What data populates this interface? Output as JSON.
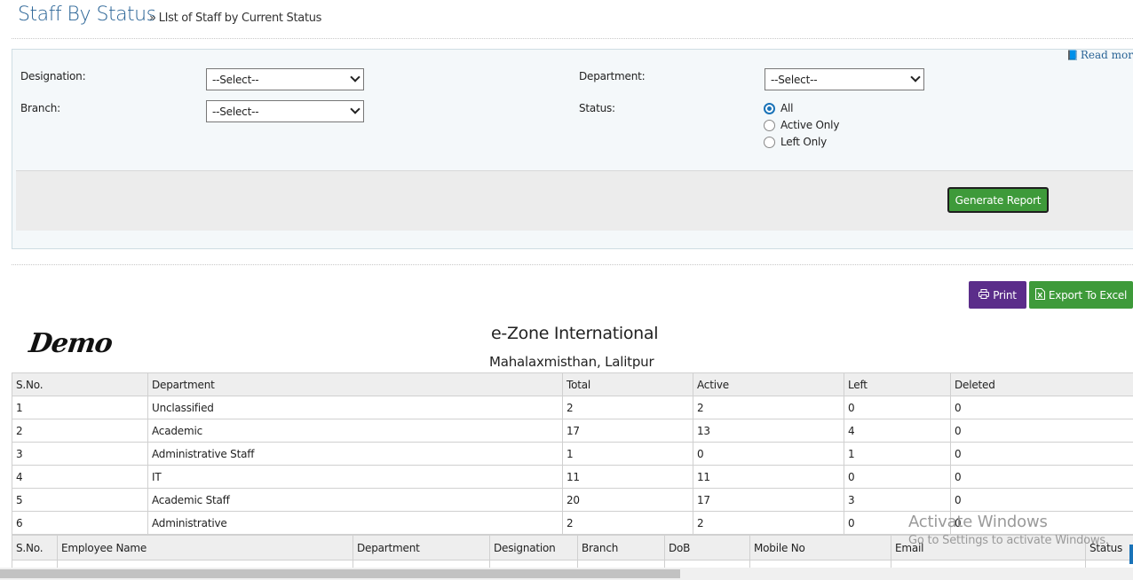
{
  "page": {
    "title": "Staff By Status",
    "subtitle": "LIst of Staff by Current Status",
    "read_more": "Read mor"
  },
  "filters": {
    "designation_label": "Designation:",
    "designation_value": "--Select--",
    "branch_label": "Branch:",
    "branch_value": "--Select--",
    "department_label": "Department:",
    "department_value": "--Select--",
    "status_label": "Status:",
    "status_options": [
      {
        "label": "All",
        "selected": true
      },
      {
        "label": "Active Only",
        "selected": false
      },
      {
        "label": "Left Only",
        "selected": false
      }
    ],
    "generate_label": "Generate Report"
  },
  "report": {
    "print_label": "Print",
    "excel_label": "Export To Excel",
    "org_name": "e-Zone International",
    "address": "Mahalaxmisthan, Lalitpur",
    "logo_text": "Demo"
  },
  "summary": {
    "headers": [
      "S.No.",
      "Department",
      "Total",
      "Active",
      "Left",
      "Deleted"
    ],
    "rows": [
      [
        "1",
        "Unclassified",
        "2",
        "2",
        "0",
        "0"
      ],
      [
        "2",
        "Academic",
        "17",
        "13",
        "4",
        "0"
      ],
      [
        "3",
        "Administrative Staff",
        "1",
        "0",
        "1",
        "0"
      ],
      [
        "4",
        "IT",
        "11",
        "11",
        "0",
        "0"
      ],
      [
        "5",
        "Academic Staff",
        "20",
        "17",
        "3",
        "0"
      ],
      [
        "6",
        "Administrative",
        "2",
        "2",
        "0",
        "0"
      ]
    ]
  },
  "detail": {
    "headers": [
      "S.No.",
      "Employee Name",
      "Department",
      "Designation",
      "Branch",
      "DoB",
      "Mobile No",
      "Email",
      "Status"
    ]
  },
  "watermark": {
    "line1": "Activate Windows",
    "line2": "Go to Settings to activate Windows."
  },
  "colors": {
    "title": "#2a6496",
    "generate_button": "#3e9a3a",
    "print_button": "#5b2d8a",
    "excel_button": "#3e9a3a",
    "radio_selected": "#1a73b8"
  }
}
